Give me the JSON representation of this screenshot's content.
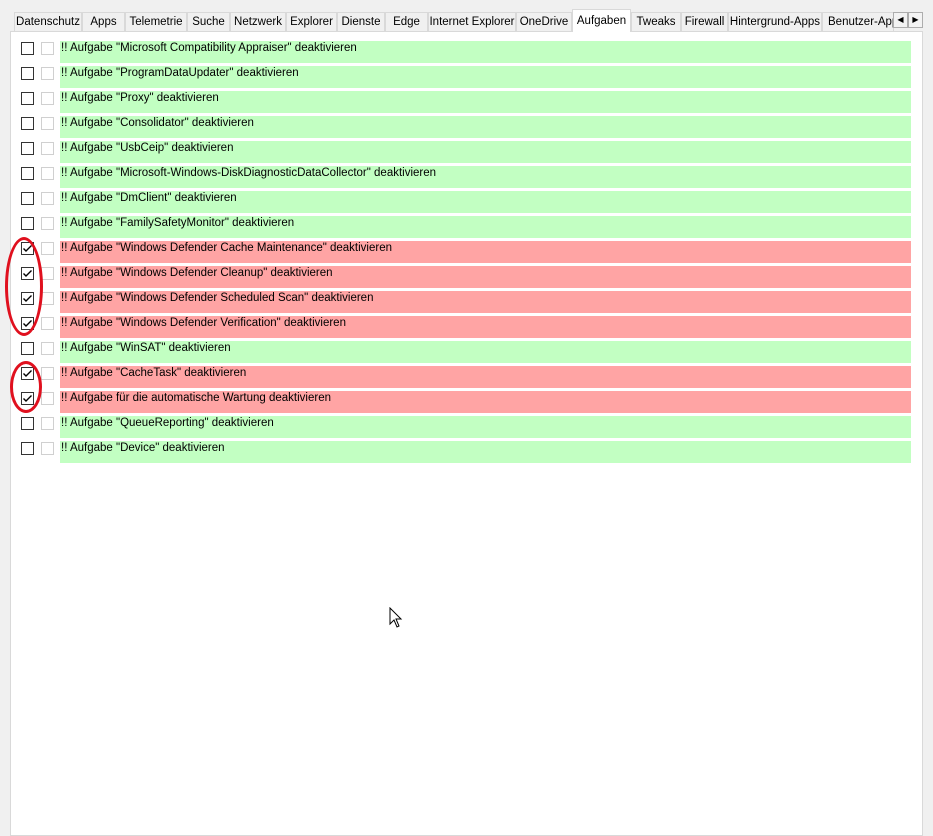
{
  "tabs": [
    {
      "label": "Datenschutz",
      "active": false
    },
    {
      "label": "Apps",
      "active": false
    },
    {
      "label": "Telemetrie",
      "active": false
    },
    {
      "label": "Suche",
      "active": false
    },
    {
      "label": "Netzwerk",
      "active": false
    },
    {
      "label": "Explorer",
      "active": false
    },
    {
      "label": "Dienste",
      "active": false
    },
    {
      "label": "Edge",
      "active": false
    },
    {
      "label": "Internet Explorer",
      "active": false
    },
    {
      "label": "OneDrive",
      "active": false
    },
    {
      "label": "Aufgaben",
      "active": true
    },
    {
      "label": "Tweaks",
      "active": false
    },
    {
      "label": "Firewall",
      "active": false
    },
    {
      "label": "Hintergrund-Apps",
      "active": false
    },
    {
      "label": "Benutzer-App",
      "active": false
    }
  ],
  "scroll_buttons": {
    "left": "◀",
    "right": "▶"
  },
  "colors": {
    "enabled_bg": "#c2ffc2",
    "disabled_bg": "#ffa4a4",
    "highlight_ring": "#e0101e"
  },
  "tasks": [
    {
      "label": "!! Aufgabe \"Microsoft Compatibility Appraiser\" deaktivieren",
      "checked": false
    },
    {
      "label": "!! Aufgabe \"ProgramDataUpdater\" deaktivieren",
      "checked": false
    },
    {
      "label": "!! Aufgabe \"Proxy\" deaktivieren",
      "checked": false
    },
    {
      "label": "!! Aufgabe \"Consolidator\" deaktivieren",
      "checked": false
    },
    {
      "label": "!! Aufgabe \"UsbCeip\" deaktivieren",
      "checked": false
    },
    {
      "label": "!! Aufgabe \"Microsoft-Windows-DiskDiagnosticDataCollector\" deaktivieren",
      "checked": false
    },
    {
      "label": "!! Aufgabe \"DmClient\" deaktivieren",
      "checked": false
    },
    {
      "label": "!! Aufgabe \"FamilySafetyMonitor\"  deaktivieren",
      "checked": false
    },
    {
      "label": "!! Aufgabe \"Windows Defender Cache Maintenance\" deaktivieren",
      "checked": true
    },
    {
      "label": "!! Aufgabe \"Windows Defender Cleanup\" deaktivieren",
      "checked": true
    },
    {
      "label": "!! Aufgabe \"Windows Defender Scheduled Scan\" deaktivieren",
      "checked": true
    },
    {
      "label": "!! Aufgabe \"Windows Defender Verification\" deaktivieren",
      "checked": true
    },
    {
      "label": "!! Aufgabe \"WinSAT\" deaktivieren",
      "checked": false
    },
    {
      "label": "!! Aufgabe \"CacheTask\" deaktivieren",
      "checked": true
    },
    {
      "label": "!! Aufgabe für die automatische Wartung deaktivieren",
      "checked": true
    },
    {
      "label": "!! Aufgabe \"QueueReporting\" deaktivieren",
      "checked": false
    },
    {
      "label": "!! Aufgabe \"Device\" deaktivieren",
      "checked": false
    }
  ]
}
